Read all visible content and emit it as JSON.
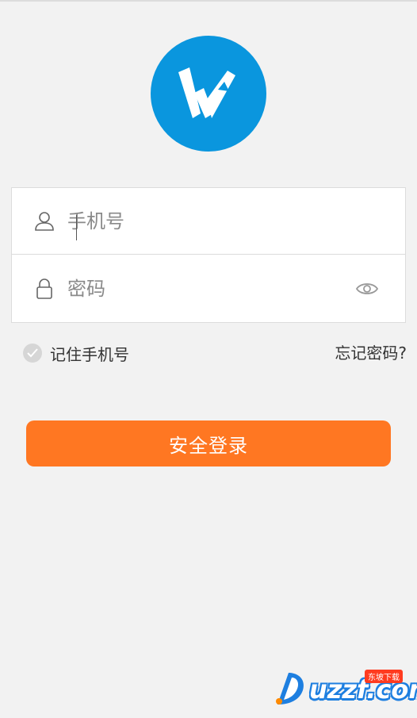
{
  "login": {
    "phone_placeholder": "手机号",
    "password_placeholder": "密码",
    "remember_label": "记住手机号",
    "forgot_label": "忘记密码?",
    "submit_label": "安全登录"
  },
  "icons": {
    "logo": "w-logo-icon",
    "phone": "user-icon",
    "password": "lock-icon",
    "toggle": "eye-icon",
    "remember": "check-icon"
  },
  "watermark": {
    "text": "uzzf.com",
    "tag": "东坡下载"
  },
  "colors": {
    "background": "#f2f2f2",
    "logo_blue": "#0a96de",
    "primary_button": "#ff7722",
    "border": "#dcdcdc"
  }
}
